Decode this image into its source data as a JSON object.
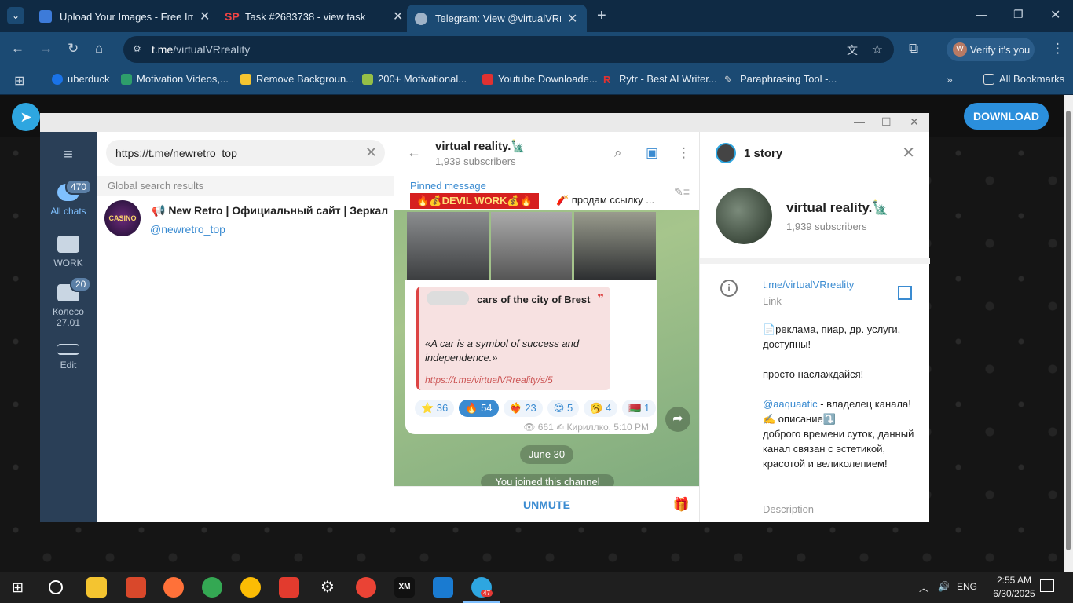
{
  "browser": {
    "tabs": [
      {
        "title": "Upload Your Images - Free Imag",
        "active": false
      },
      {
        "title": "Task #2683738 - view task",
        "active": false
      },
      {
        "title": "Telegram: View @virtualVRreality",
        "active": true
      }
    ],
    "address": {
      "host": "t.me",
      "path": "/virtualVRreality"
    },
    "verify_label": "Verify it's you",
    "bookmarks": [
      "uberduck",
      "Motivation Videos,...",
      "Remove Backgroun...",
      "200+ Motivational...",
      "Youtube Downloade...",
      "Rytr - Best AI Writer...",
      "Paraphrasing Tool -..."
    ],
    "all_bookmarks": "All Bookmarks"
  },
  "page": {
    "download_label": "DOWNLOAD"
  },
  "tg": {
    "rail": {
      "all_chats": "All chats",
      "all_chats_badge": "470",
      "work": "WORK",
      "koleso": "Колесо 27.01",
      "koleso_badge": "20",
      "edit": "Edit"
    },
    "search_value": "https://t.me/newretro_top",
    "global_results": "Global search results",
    "result": {
      "avatar_text": "CASINO",
      "name": "📢 New Retro | Официальный сайт | Зеркал...",
      "username": "@newretro_top"
    },
    "chat": {
      "name": "virtual reality.🗽",
      "subs": "1,939 subscribers",
      "pinned_label": "Pinned message",
      "pinned_img": "🔥💰DEVIL WORK💰🔥",
      "pinned_text": "🧨 продам ссылку ...",
      "quote_title": "cars of the city of Brest",
      "quote_body": "«A car is a symbol of success and independence.»",
      "quote_link": "https://t.me/virtualVRreality/s/5",
      "reactions": [
        {
          "label": "⭐ 36",
          "on": false
        },
        {
          "label": "🔥 54",
          "on": true
        },
        {
          "label": "❤️‍🔥 23",
          "on": false
        },
        {
          "label": "😍 5",
          "on": false
        },
        {
          "label": "🥱 4",
          "on": false
        },
        {
          "label": "🇧🇾 1",
          "on": false
        }
      ],
      "meta": "👁 661 ✍ Кириллко, 5:10 PM",
      "date": "June 30",
      "service": "You joined this channel",
      "unmute": "UNMUTE"
    },
    "info": {
      "story": "1 story",
      "name": "virtual reality.🗽",
      "subs": "1,939 subscribers",
      "link": "t.me/virtualVRreality",
      "link_label": "Link",
      "desc_1": "📄реклама, пиар, др. услуги, доступны!",
      "desc_2": "просто наслаждайся!",
      "desc_mention": "@aaquaatic",
      "desc_3": " - владелец канала!",
      "desc_4": "✍️ описание⤵️",
      "desc_5": "доброго времени суток, данный канал связан с эстетикой, красотой и великолепием!",
      "desc_label": "Description"
    }
  },
  "taskbar": {
    "lang": "ENG",
    "time": "2:55 AM",
    "date": "6/30/2025",
    "telegram_badge": "47"
  },
  "colors": {
    "accent": "#3a8bd1",
    "chrome_dark": "#0f2a44",
    "chrome": "#1b4a73",
    "rail": "#2a3f57"
  }
}
